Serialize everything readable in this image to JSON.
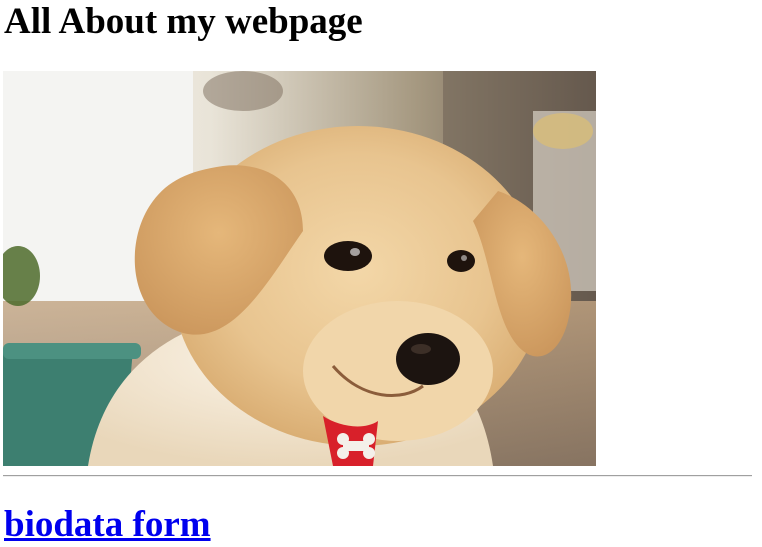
{
  "page": {
    "title": "All About my webpage"
  },
  "photo": {
    "subject": "puppy-photo",
    "colors": {
      "background_wall": "#f2f0ea",
      "fur": "#e8c48f",
      "collar": "#d8202a",
      "pot": "#3d7f70"
    }
  },
  "links": {
    "biodata_form": "biodata form"
  },
  "colors": {
    "link": "#0000ee",
    "divider": "#a0a0a0"
  }
}
